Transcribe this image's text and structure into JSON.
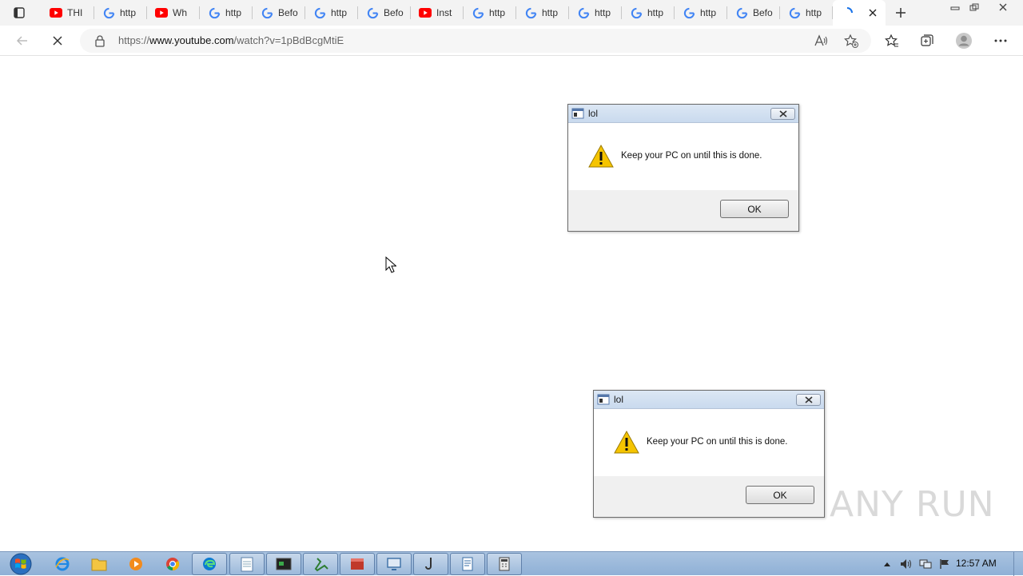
{
  "browser": {
    "tabs": [
      {
        "title": "THI",
        "icon": "youtube-icon"
      },
      {
        "title": "http",
        "icon": "google-icon"
      },
      {
        "title": "Wh",
        "icon": "youtube-icon"
      },
      {
        "title": "http",
        "icon": "google-icon"
      },
      {
        "title": "Befo",
        "icon": "google-icon"
      },
      {
        "title": "http",
        "icon": "google-icon"
      },
      {
        "title": "Befo",
        "icon": "google-icon"
      },
      {
        "title": "Inst",
        "icon": "youtube-icon"
      },
      {
        "title": "http",
        "icon": "google-icon"
      },
      {
        "title": "http",
        "icon": "google-icon"
      },
      {
        "title": "http",
        "icon": "google-icon"
      },
      {
        "title": "http",
        "icon": "google-icon"
      },
      {
        "title": "http",
        "icon": "google-icon"
      },
      {
        "title": "Befo",
        "icon": "google-icon"
      },
      {
        "title": "http",
        "icon": "google-icon"
      }
    ],
    "active_tab": {
      "title": "",
      "icon": "loading-icon"
    },
    "address": {
      "prefix": "https://",
      "host": "www.youtube.com",
      "path": "/watch?v=1pBdBcgMtiE"
    }
  },
  "dialogs": [
    {
      "title": "lol",
      "message": "Keep your PC on until this is done.",
      "ok_label": "OK"
    },
    {
      "title": "lol",
      "message": "Keep your PC on until this is done.",
      "ok_label": "OK"
    }
  ],
  "watermark": {
    "text": "ANY RUN"
  },
  "taskbar": {
    "clock": "12:57 AM",
    "pinned": [
      "internet-explorer-icon",
      "file-explorer-icon",
      "media-player-icon",
      "chrome-icon",
      "edge-icon",
      "notepad-icon",
      "terminal-icon",
      "tool-icon",
      "archive-icon",
      "remote-icon",
      "hook-icon",
      "document-icon",
      "calculator-icon"
    ]
  },
  "colors": {
    "youtube_red": "#ff0000",
    "taskbar": "#9dbbdc",
    "dialog_title": "#d3e1f1"
  }
}
